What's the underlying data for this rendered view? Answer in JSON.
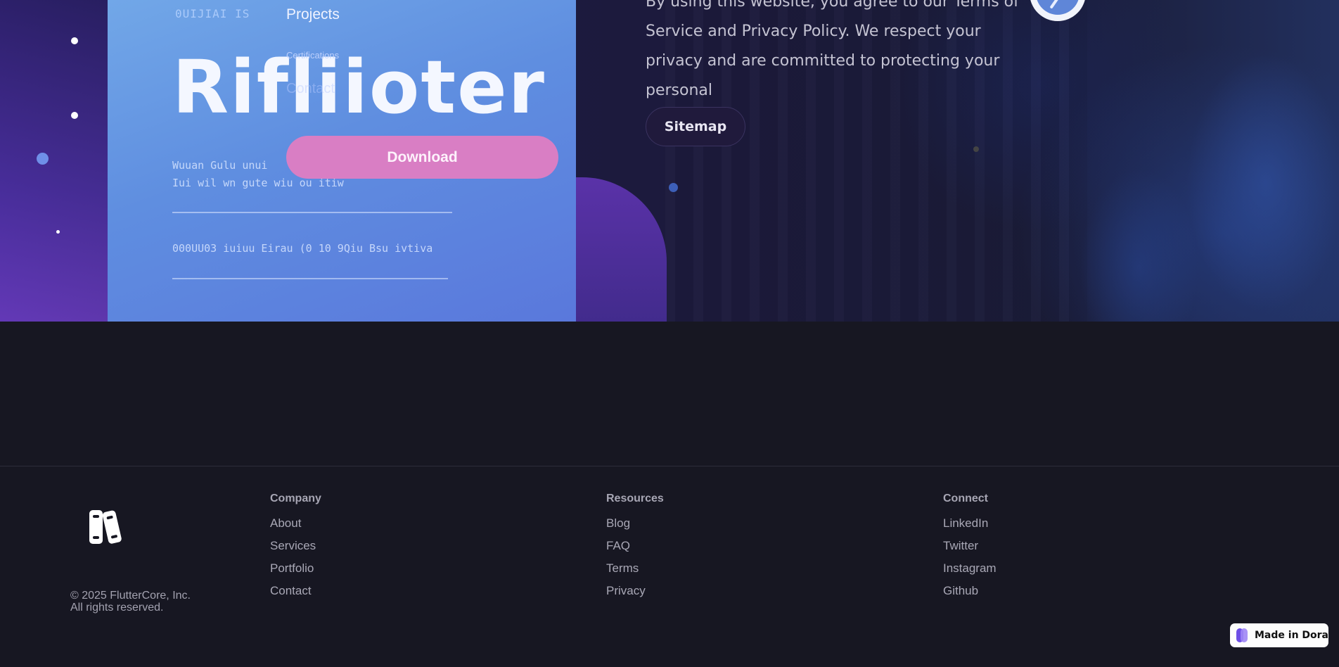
{
  "hero": {
    "poster": {
      "small_top": "0UIJIAI IS",
      "title": "Rifliioter",
      "line1": "Wuuan Gulu unui",
      "line2": "Iui wil wn gute  wiu ou itiw",
      "line3": "000UU03 iuiuu Eirau  (0 10 9Qiu  Bsu ivtiva"
    },
    "nav": {
      "projects": "Projects",
      "certifications": "Certifications",
      "contact": "Contact"
    },
    "download_label": "Download",
    "policy_text": "By using this website, you agree to our Terms of Service and Privacy Policy. We respect your privacy and are committed to protecting your personal",
    "sitemap_label": "Sitemap"
  },
  "footer": {
    "logo_icon": "books-icon",
    "copyright_line1": "© 2025 FlutterCore, Inc.",
    "copyright_line2": "All rights reserved.",
    "columns": [
      {
        "title": "Company",
        "links": [
          "About",
          "Services",
          "Portfolio",
          "Contact"
        ]
      },
      {
        "title": "Resources",
        "links": [
          "Blog",
          "FAQ",
          "Terms",
          "Privacy"
        ]
      },
      {
        "title": "Connect",
        "links": [
          "LinkedIn",
          "Twitter",
          "Instagram",
          "Github"
        ]
      }
    ]
  },
  "badge": {
    "label": "Made in Dora"
  },
  "colors": {
    "background": "#171722",
    "download": "#d97ec4",
    "poster": "#5f8ee0",
    "footer_text": "#a9a8b6"
  }
}
